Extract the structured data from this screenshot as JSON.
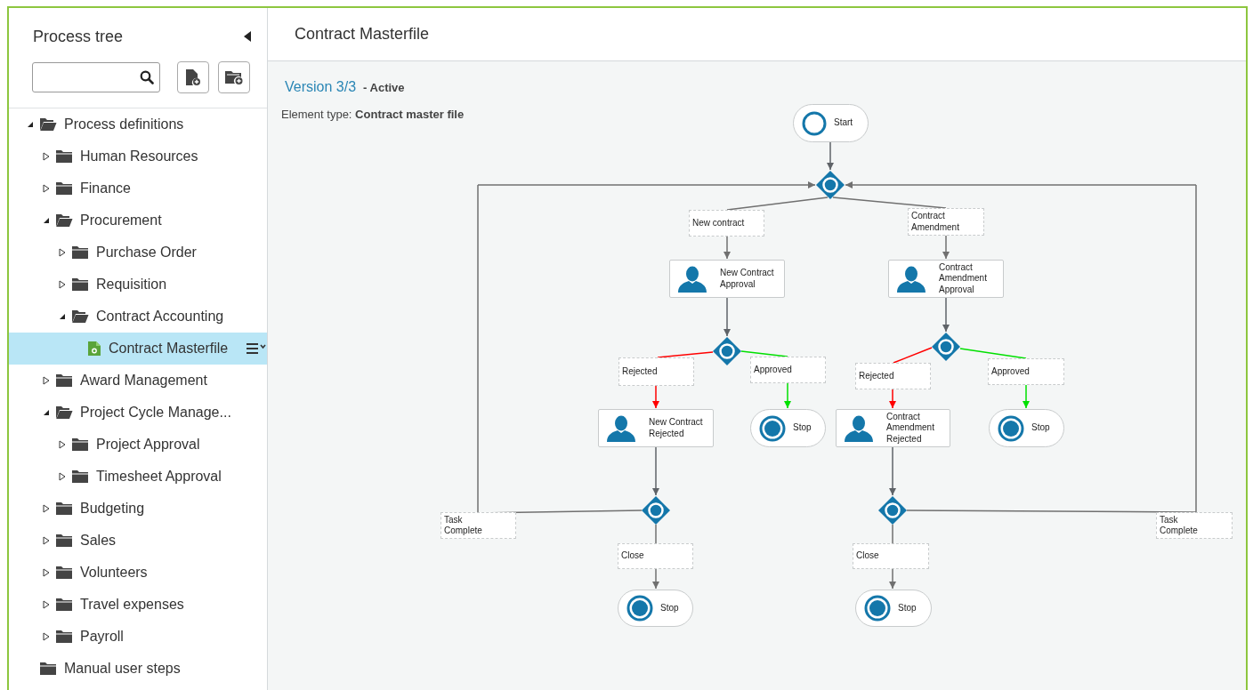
{
  "sidebar": {
    "title": "Process tree",
    "tree": [
      {
        "label": "Process definitions",
        "kind": "folder",
        "expanded": true,
        "selected": false,
        "children": [
          {
            "label": "Human Resources",
            "kind": "folder",
            "expanded": false,
            "selected": false
          },
          {
            "label": "Finance",
            "kind": "folder",
            "expanded": false,
            "selected": false
          },
          {
            "label": "Procurement",
            "kind": "folder",
            "expanded": true,
            "selected": false,
            "children": [
              {
                "label": "Purchase Order",
                "kind": "folder",
                "expanded": false,
                "selected": false
              },
              {
                "label": "Requisition",
                "kind": "folder",
                "expanded": false,
                "selected": false
              },
              {
                "label": "Contract Accounting",
                "kind": "folder",
                "expanded": true,
                "selected": false,
                "children": [
                  {
                    "label": "Contract Masterfile",
                    "kind": "file",
                    "expanded": false,
                    "selected": true
                  }
                ]
              }
            ]
          },
          {
            "label": "Award Management",
            "kind": "folder",
            "expanded": false,
            "selected": false
          },
          {
            "label": "Project Cycle Manage...",
            "kind": "folder",
            "expanded": true,
            "selected": false,
            "children": [
              {
                "label": "Project Approval",
                "kind": "folder",
                "expanded": false,
                "selected": false
              },
              {
                "label": "Timesheet Approval",
                "kind": "folder",
                "expanded": false,
                "selected": false
              }
            ]
          },
          {
            "label": "Budgeting",
            "kind": "folder",
            "expanded": false,
            "selected": false
          },
          {
            "label": "Sales",
            "kind": "folder",
            "expanded": false,
            "selected": false
          },
          {
            "label": "Volunteers",
            "kind": "folder",
            "expanded": false,
            "selected": false
          },
          {
            "label": "Travel expenses",
            "kind": "folder",
            "expanded": false,
            "selected": false
          },
          {
            "label": "Payroll",
            "kind": "folder",
            "expanded": false,
            "selected": false
          }
        ]
      },
      {
        "label": "Manual user steps",
        "kind": "group",
        "expanded": false,
        "selected": false
      }
    ]
  },
  "main": {
    "title": "Contract Masterfile",
    "version": "Version 3/3",
    "status": "- Active",
    "element_type": "Element type: **Contract master file**"
  },
  "diagram": {
    "nodes": [
      {
        "kind": "start",
        "label": "Start"
      },
      {
        "kind": "gateway"
      },
      {
        "kind": "condition",
        "label": "New contract",
        "color": "#707070"
      },
      {
        "kind": "condition",
        "label": "Contract\nAmendment",
        "color": "#707070"
      },
      {
        "kind": "task",
        "label": "New Contract\nApproval"
      },
      {
        "kind": "task",
        "label": "Contract\nAmendment\nApproval"
      },
      {
        "kind": "gateway"
      },
      {
        "kind": "gateway"
      },
      {
        "kind": "condition",
        "label": "Rejected",
        "color": "#ff0000"
      },
      {
        "kind": "condition",
        "label": "Approved",
        "color": "#00e000"
      },
      {
        "kind": "condition",
        "label": "Rejected",
        "color": "#ff0000"
      },
      {
        "kind": "condition",
        "label": "Approved",
        "color": "#00e000"
      },
      {
        "kind": "task",
        "label": "New Contract\nRejected"
      },
      {
        "kind": "stop",
        "label": "Stop"
      },
      {
        "kind": "task",
        "label": "Contract\nAmendment\nRejected"
      },
      {
        "kind": "stop",
        "label": "Stop"
      },
      {
        "kind": "gateway"
      },
      {
        "kind": "gateway"
      },
      {
        "kind": "condition",
        "label": "Task\nComplete",
        "color": "#707070"
      },
      {
        "kind": "condition",
        "label": "Task\nComplete",
        "color": "#707070"
      },
      {
        "kind": "condition",
        "label": "Close",
        "color": "#707070"
      },
      {
        "kind": "condition",
        "label": "Close",
        "color": "#707070"
      },
      {
        "kind": "stop",
        "label": "Stop"
      },
      {
        "kind": "stop",
        "label": "Stop"
      }
    ]
  }
}
